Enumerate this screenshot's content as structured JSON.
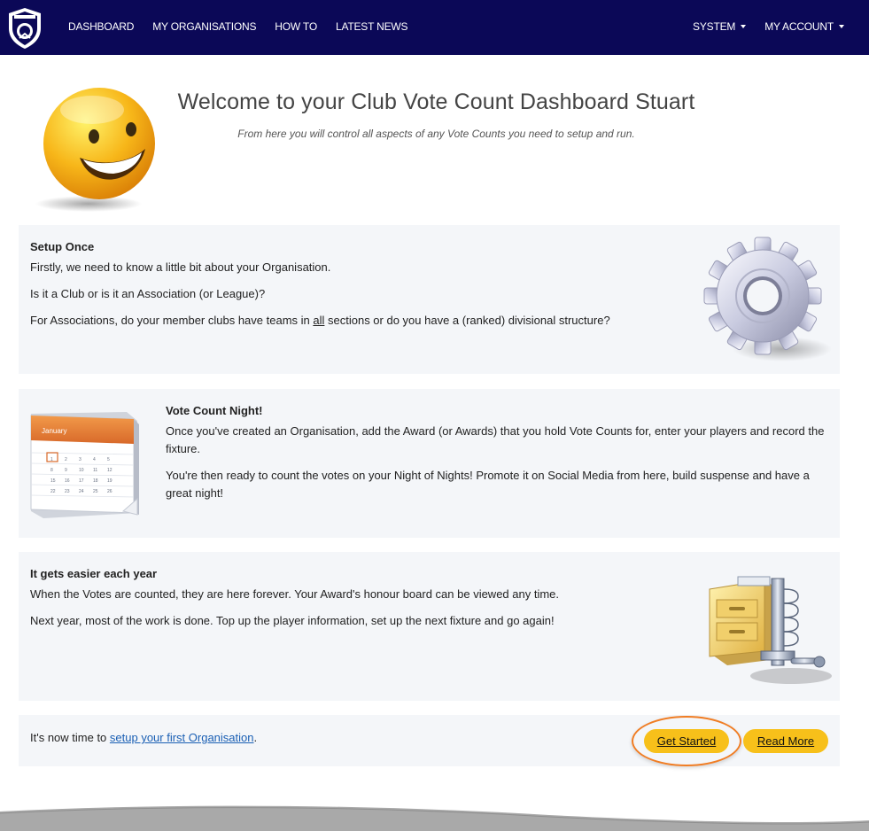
{
  "nav": {
    "logo_icon": "club-crest-icon",
    "left_items": [
      "DASHBOARD",
      "MY ORGANISATIONS",
      "HOW TO",
      "LATEST NEWS"
    ],
    "right_items": [
      "SYSTEM",
      "MY ACCOUNT"
    ],
    "background": "#0b0857"
  },
  "header": {
    "title": "Welcome to your Club Vote Count Dashboard Stuart",
    "subtitle": "From here you will control all aspects of any Vote Counts you need to setup and run.",
    "image_icon": "smiley-face-icon"
  },
  "cards": {
    "setup": {
      "title": "Setup Once",
      "p1": "Firstly, we need to know a little bit about your Organisation.",
      "p2": "Is it a Club or is it an Association (or League)?",
      "p3_before": "For Associations, do your member clubs have teams in ",
      "p3_underlined": "all",
      "p3_after": " sections or do you have a (ranked) divisional structure?",
      "image_icon": "gear-icon"
    },
    "vote_night": {
      "title": "Vote Count Night!",
      "p1": "Once you've created an Organisation, add the Award (or Awards) that you hold Vote Counts for, enter your players and record the fixture.",
      "p2": "You're then ready to count the votes on your Night of Nights! Promote it on Social Media from here, build suspense and have a great night!",
      "image_icon": "calendar-icon",
      "calendar_month": "January"
    },
    "easier": {
      "title": "It gets easier each year",
      "p1": "When the Votes are counted, they are here forever. Your Award's honour board can be viewed any time.",
      "p2": "Next year, most of the work is done. Top up the player information, set up the next fixture and go again!",
      "image_icon": "archive-cabinet-icon"
    },
    "cta": {
      "text_before": "It's now time to ",
      "link": "setup your first Organisation",
      "text_after": ".",
      "get_started": "Get Started",
      "read_more": "Read More",
      "button_color": "#f7c01a",
      "highlight_color": "#f07d24"
    }
  }
}
